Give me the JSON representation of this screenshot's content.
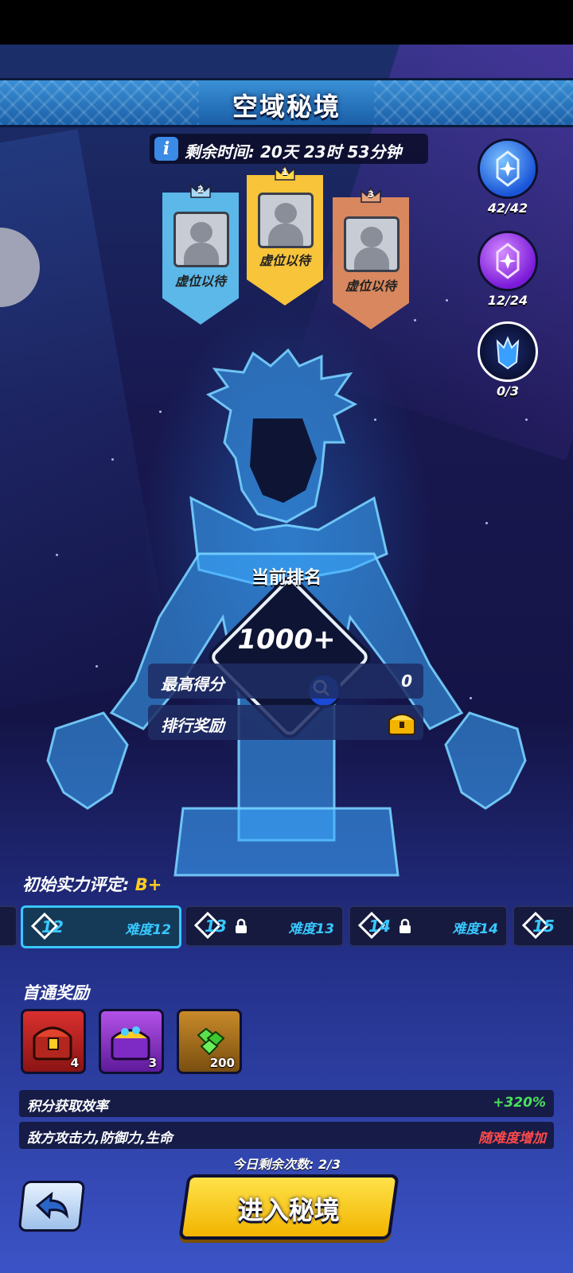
{
  "title": "空域秘境",
  "timer": {
    "icon": "info-icon",
    "label": "剩余时间: 20天 23时 53分钟"
  },
  "leaderboard": [
    {
      "rank": "2",
      "label": "虚位以待",
      "color": "#5bb8e8"
    },
    {
      "rank": "1",
      "label": "虚位以待",
      "color": "#f7c43a"
    },
    {
      "rank": "3",
      "label": "虚位以待",
      "color": "#d9875e"
    }
  ],
  "resources": [
    {
      "icon": "blue-crystal-icon",
      "value": "42/42"
    },
    {
      "icon": "purple-crystal-icon",
      "value": "12/24"
    },
    {
      "icon": "dark-crystal-icon",
      "value": "0/3"
    }
  ],
  "ranking": {
    "title": "当前排名",
    "value": "1000+"
  },
  "stats": {
    "high_score_label": "最高得分",
    "high_score_value": "0",
    "reward_label": "排行奖励"
  },
  "assessment": {
    "label": "初始实力评定: ",
    "grade": "B+"
  },
  "difficulties": [
    {
      "num": "12",
      "label": "难度12",
      "locked": false,
      "active": true
    },
    {
      "num": "13",
      "label": "难度13",
      "locked": true,
      "active": false
    },
    {
      "num": "14",
      "label": "难度14",
      "locked": true,
      "active": false
    },
    {
      "num": "15",
      "label": "",
      "locked": true,
      "active": false
    }
  ],
  "first_clear": {
    "title": "首通奖励",
    "items": [
      {
        "icon": "red-chest-icon",
        "amount": "4"
      },
      {
        "icon": "purple-chest-icon",
        "amount": "3"
      },
      {
        "icon": "green-gem-icon",
        "amount": "200"
      }
    ]
  },
  "efficiency": {
    "label": "积分获取效率",
    "value": "+320%",
    "value_color": "#49e05a"
  },
  "enemy": {
    "label": "敌方攻击力,防御力,生命",
    "value": "随难度增加",
    "value_color": "#ff4a4a"
  },
  "remaining": "今日剩余次数: 2/3",
  "enter_button": "进入秘境",
  "colors": {
    "accent": "#38c8ff",
    "button": "#f7c41a"
  }
}
